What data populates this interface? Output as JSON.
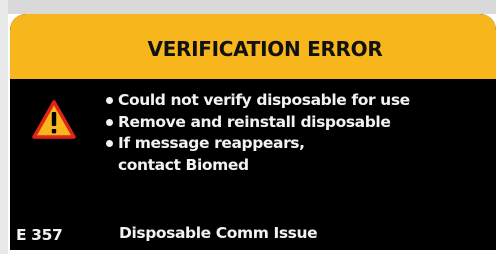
{
  "dialog": {
    "title": "VERIFICATION ERROR",
    "header_color": "#f7b61b",
    "body_color": "#000000",
    "icon": "warning-triangle-icon",
    "messages": [
      "Could not verify disposable for use",
      "Remove and reinstall disposable",
      "If message reappears, contact Biomed"
    ],
    "error_code": "E 357",
    "error_description": "Disposable Comm Issue"
  }
}
